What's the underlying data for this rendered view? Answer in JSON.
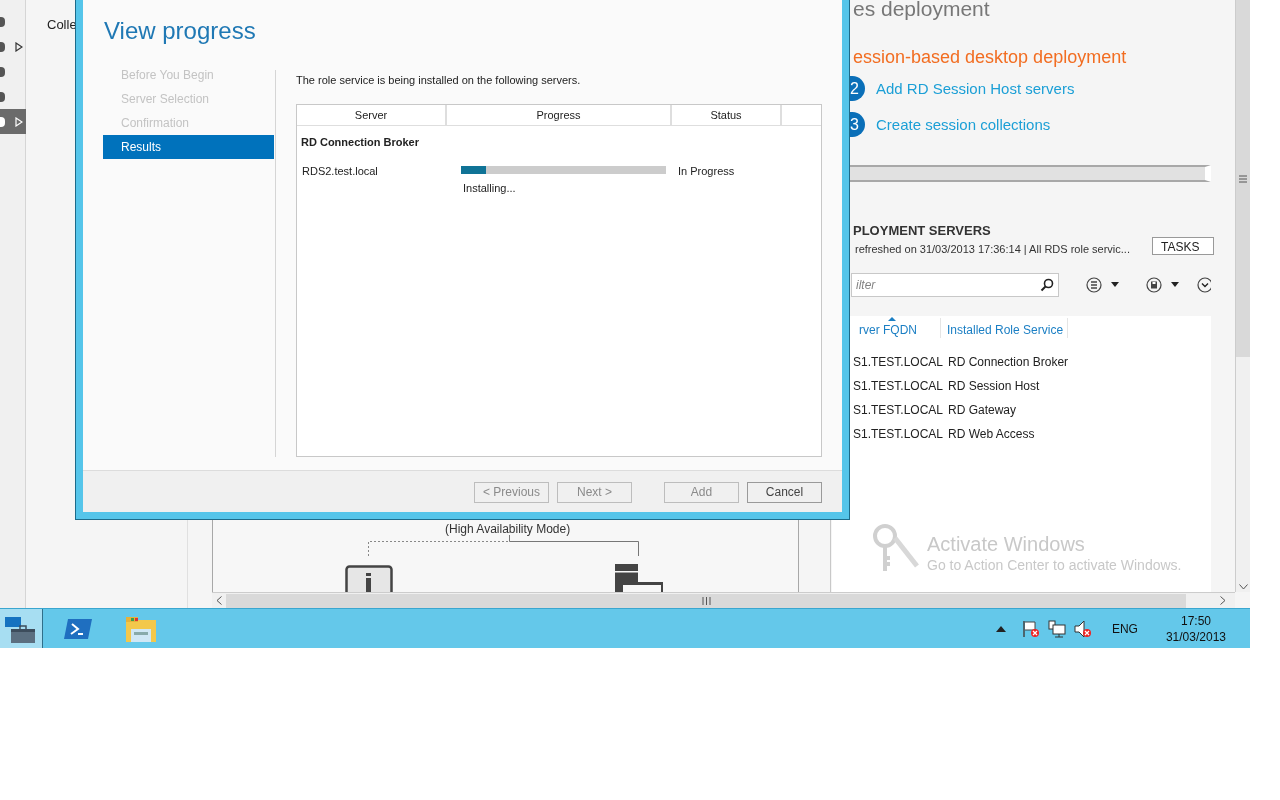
{
  "nav_rail": {
    "items": [
      {
        "selected": false,
        "expandable": false
      },
      {
        "selected": false,
        "expandable": true
      },
      {
        "selected": false,
        "expandable": false
      },
      {
        "selected": false,
        "expandable": false
      },
      {
        "selected": true,
        "expandable": true
      }
    ]
  },
  "nav_panel": {
    "items": [
      "Colle"
    ]
  },
  "background": {
    "heading": "es deployment",
    "subheading": "ession-based desktop deployment",
    "steps": [
      {
        "number": "2",
        "label": "Add RD Session Host servers"
      },
      {
        "number": "3",
        "label": "Create session collections"
      }
    ],
    "servers": {
      "title": "PLOYMENT SERVERS",
      "subtitle": "refreshed on 31/03/2013 17:36:14 | All RDS role servic...",
      "tasks_button": "TASKS",
      "filter_placeholder": "ilter",
      "columns": [
        "rver FQDN",
        "Installed Role Service"
      ],
      "rows": [
        [
          "S1.TEST.LOCAL",
          "RD Connection Broker"
        ],
        [
          "S1.TEST.LOCAL",
          "RD Session Host"
        ],
        [
          "S1.TEST.LOCAL",
          "RD Gateway"
        ],
        [
          "S1.TEST.LOCAL",
          "RD Web Access"
        ]
      ]
    },
    "diagram": {
      "caption": "(High Availability Mode)"
    }
  },
  "watermark": {
    "title": "Activate Windows",
    "text": "Go to Action Center to activate Windows."
  },
  "dialog": {
    "title": "View progress",
    "steps": [
      {
        "label": "Before You Begin",
        "selected": false
      },
      {
        "label": "Server Selection",
        "selected": false
      },
      {
        "label": "Confirmation",
        "selected": false
      },
      {
        "label": "Results",
        "selected": true
      }
    ],
    "message": "The role service is being installed on the following servers.",
    "table": {
      "columns": [
        "Server",
        "Progress",
        "Status"
      ],
      "group": "RD Connection Broker",
      "rows": [
        {
          "server": "RDS2.test.local",
          "level": 0.12,
          "status": "In Progress",
          "detail": "Installing..."
        }
      ]
    },
    "buttons": [
      {
        "label": "< Previous",
        "disabled": true
      },
      {
        "label": "Next >",
        "disabled": true
      },
      {
        "label": "Add",
        "disabled": true
      },
      {
        "label": "Cancel",
        "disabled": false
      }
    ]
  },
  "taskbar": {
    "apps": [
      {
        "kind": "server-manager",
        "selected": true
      },
      {
        "kind": "powershell",
        "selected": false
      },
      {
        "kind": "explorer",
        "selected": false
      }
    ],
    "language": "ENG",
    "time": "17:50",
    "date": "31/03/2013"
  }
}
